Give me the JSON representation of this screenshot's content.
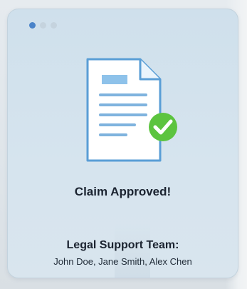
{
  "pagination": {
    "dots": [
      {
        "state": "active"
      },
      {
        "state": "idle"
      },
      {
        "state": "idle"
      }
    ],
    "active_index": 0
  },
  "illustration": {
    "document_icon": "document-icon",
    "check_icon": "check-circle-icon",
    "colors": {
      "document_stroke": "#5a9ed6",
      "document_fill": "#ffffff",
      "document_header": "#8ec2ea",
      "check_fill": "#5cc43f"
    }
  },
  "status": {
    "title": "Claim Approved!"
  },
  "team": {
    "title": "Legal Support Team:",
    "members": "John Doe, Jane Smith, Alex Chen"
  }
}
